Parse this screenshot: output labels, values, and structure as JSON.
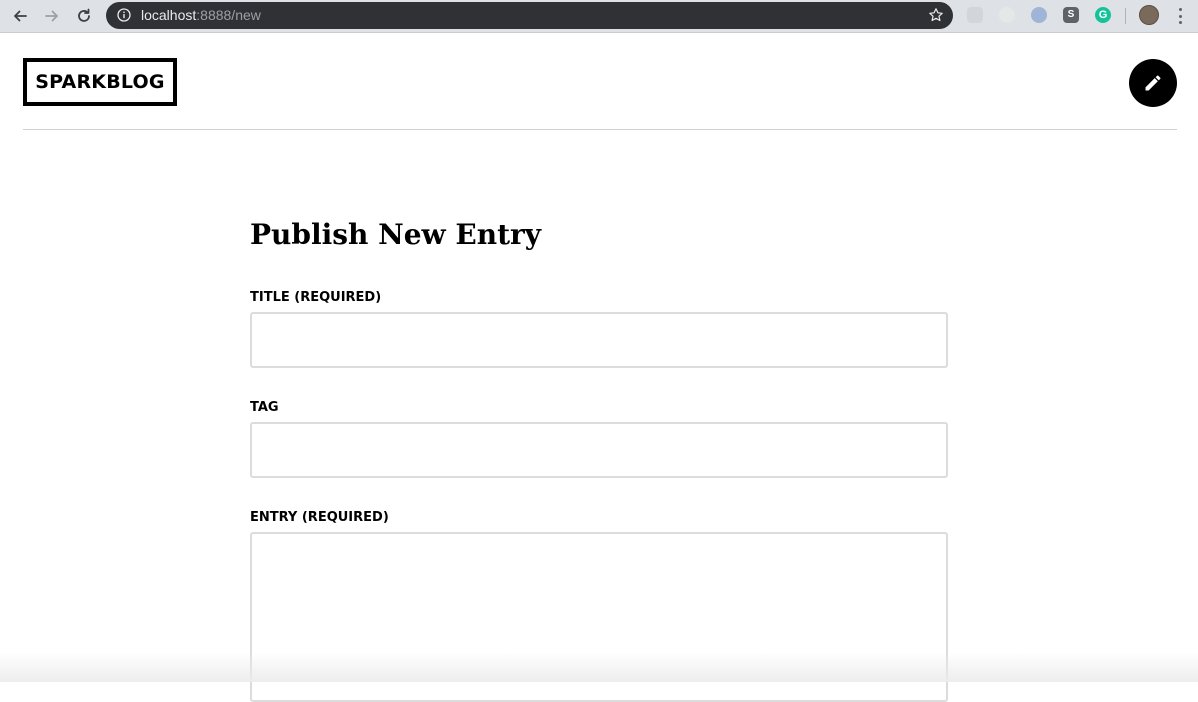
{
  "browser": {
    "url_host": "localhost",
    "url_path": ":8888/new",
    "extension_s_label": "S",
    "extension_g_label": "G",
    "icons": [
      "back-arrow-icon",
      "forward-arrow-icon",
      "reload-icon",
      "info-icon",
      "star-icon",
      "menu-dots-icon"
    ]
  },
  "header": {
    "logo_text": "SPARKBLOG",
    "compose_icon": "pencil-icon"
  },
  "form": {
    "heading": "Publish New Entry",
    "title_label": "TITLE (REQUIRED)",
    "title_value": "",
    "tag_label": "TAG",
    "tag_value": "",
    "entry_label": "ENTRY (REQUIRED)",
    "entry_value": ""
  },
  "colors": {
    "accent": "#000000",
    "field_border": "#dcdcdc",
    "rule": "#d0d0d0"
  }
}
